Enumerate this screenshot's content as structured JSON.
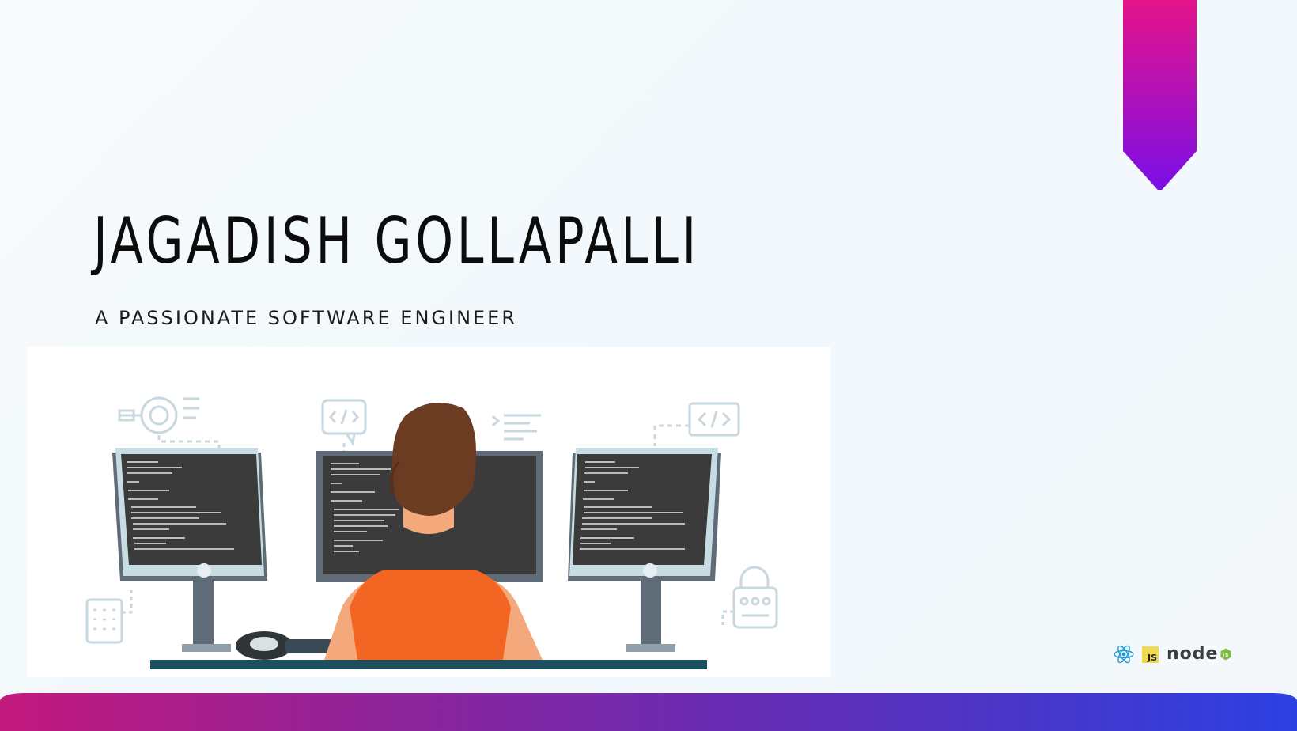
{
  "hero": {
    "name": "JAGADISH GOLLAPALLI",
    "tagline": "A PASSIONATE SOFTWARE ENGINEER"
  },
  "tech_logos": {
    "icons": [
      "react-icon",
      "javascript-icon",
      "nodejs-icon"
    ],
    "js_text": "JS",
    "node_text": "node"
  },
  "colors": {
    "bookmark_top": "#e5148a",
    "bookmark_bottom": "#7b0ee6",
    "shirt": "#f26522",
    "hair": "#6b3b22",
    "skin": "#f4a97c",
    "monitor_frame": "#5f6b76",
    "screen": "#3b3b3b",
    "desk": "#1d4f5c",
    "bar_left": "#c2187c",
    "bar_right": "#2c40e2"
  }
}
